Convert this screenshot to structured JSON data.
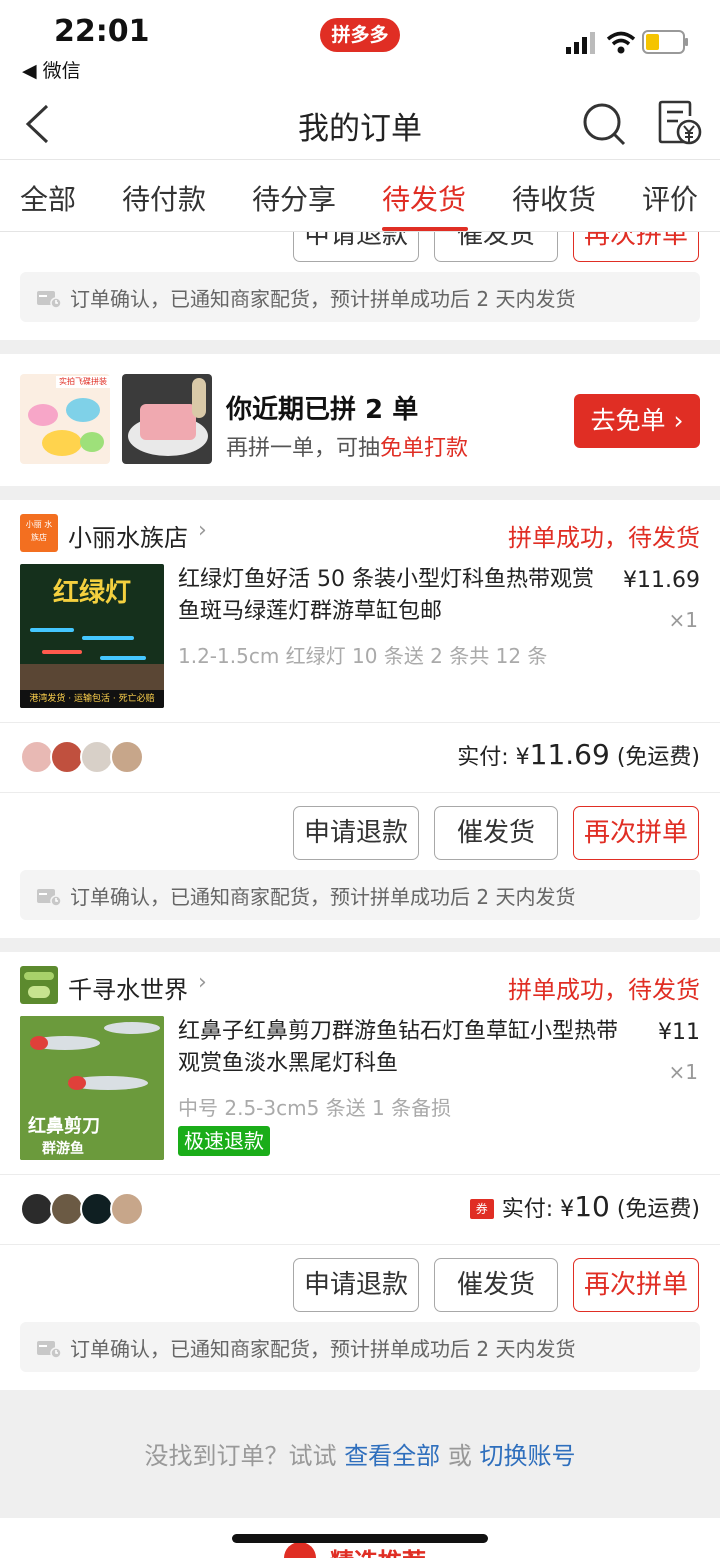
{
  "status_bar": {
    "time": "22:01",
    "back_app": "◀ 微信",
    "app_badge": "拼多多"
  },
  "nav": {
    "title": "我的订单"
  },
  "tabs": [
    {
      "label": "全部"
    },
    {
      "label": "待付款"
    },
    {
      "label": "待分享"
    },
    {
      "label": "待发货",
      "active": true
    },
    {
      "label": "待收货"
    },
    {
      "label": "评价"
    }
  ],
  "actions": {
    "refund": "申请退款",
    "urge": "催发货",
    "rebuy": "再次拼单"
  },
  "notice_text": "订单确认，已通知商家配货，预计拼单成功后 2 天内发货",
  "promo": {
    "title": "你近期已拼 2 单",
    "sub_prefix": "再拼一单，可抽",
    "sub_highlight": "免单打款",
    "button": "去免单 ›",
    "img1_text": "实拍飞碟拼装"
  },
  "orders": [
    {
      "shop_name": "小丽水族店",
      "shop_logo_text": "小丽 水族店",
      "status": "拼单成功，待发货",
      "title": "红绿灯鱼好活 50 条装小型灯科鱼热带观赏鱼斑马绿莲灯群游草缸包邮",
      "spec": "1.2-1.5cm 红绿灯 10 条送 2 条共 12 条",
      "price": "¥11.69",
      "qty": "×1",
      "thumb_title": "红绿灯",
      "thumb_footer": "港湾发货 · 运输包活 · 死亡必赔",
      "paid_label": "实付: ¥",
      "paid_amount": "11.69",
      "paid_note": "(免运费)"
    },
    {
      "shop_name": "千寻水世界",
      "status": "拼单成功，待发货",
      "title": "红鼻子红鼻剪刀群游鱼钻石灯鱼草缸小型热带观赏鱼淡水黑尾灯科鱼",
      "spec": "中号 2.5-3cm5 条送 1 条备损",
      "tag": "极速退款",
      "price": "¥11",
      "qty": "×1",
      "thumb_title": "红鼻剪刀",
      "thumb_sub": "群游鱼",
      "coupon": "券",
      "paid_label": "实付: ¥",
      "paid_amount": "10",
      "paid_note": "(免运费)"
    }
  ],
  "footer": {
    "prefix": "没找到订单？试试 ",
    "link1": "查看全部",
    "mid": " 或 ",
    "link2": "切换账号"
  },
  "recommend": "精选推荐",
  "colors": {
    "brand_red": "#e02e24",
    "green_tag": "#1aad19",
    "link_blue": "#2f6fbd"
  }
}
